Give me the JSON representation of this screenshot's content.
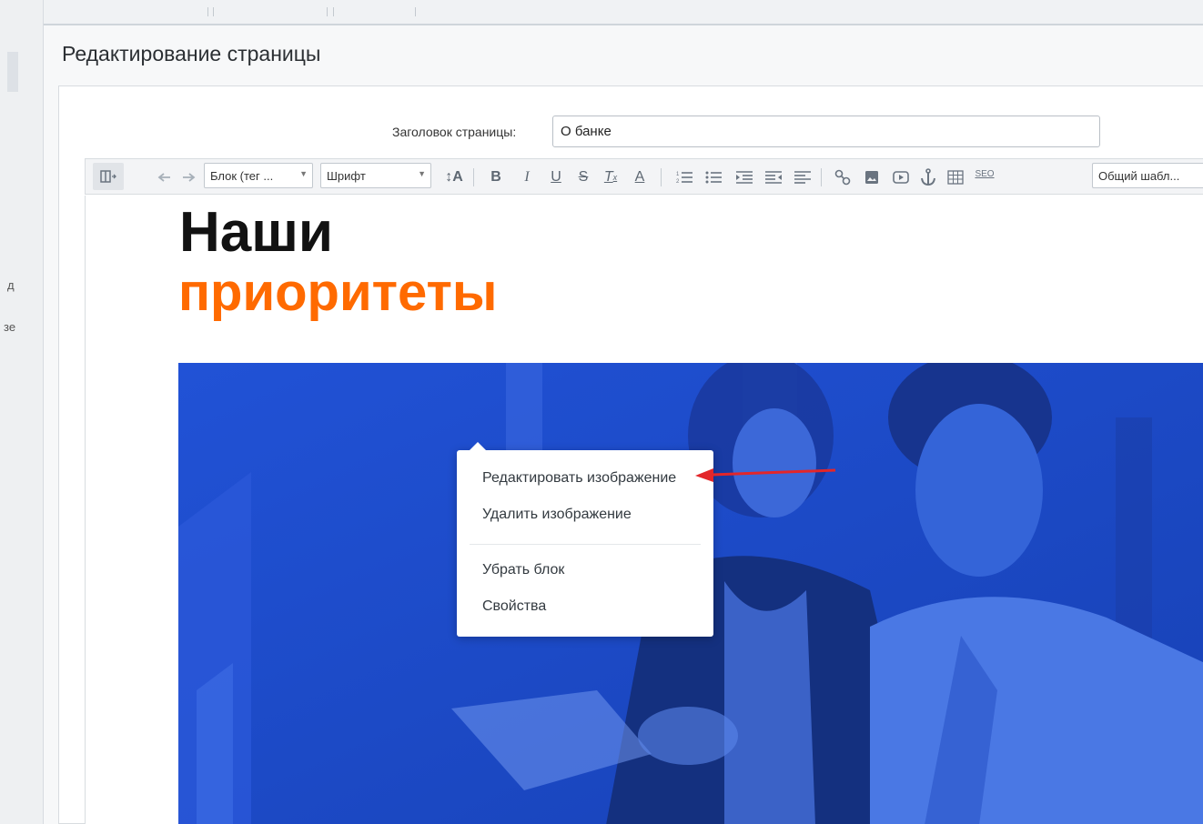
{
  "left_strip": {
    "fragment_1": "д",
    "fragment_2": "зе"
  },
  "panel": {
    "title": "Редактирование страницы"
  },
  "page_title_field": {
    "label": "Заголовок страницы:",
    "value": "О банке"
  },
  "toolbar": {
    "block_select": "Блок (тег ...",
    "font_select": "Шрифт",
    "seo_label": "SEO",
    "template_select": "Общий шабл...",
    "icons": [
      "source-toggle-icon",
      "undo-icon",
      "redo-icon",
      "font-size-icon",
      "bold-icon",
      "italic-icon",
      "underline-icon",
      "strikethrough-icon",
      "clear-format-icon",
      "text-color-icon",
      "ordered-list-icon",
      "unordered-list-icon",
      "indent-icon",
      "outdent-icon",
      "align-icon",
      "link-icon",
      "image-icon",
      "video-icon",
      "anchor-icon",
      "table-icon",
      "seo-icon"
    ]
  },
  "content": {
    "heading_line1": "Наши",
    "heading_line2": "приоритеты",
    "heading_accent_color": "#ff6a00",
    "image_overlay_color": "#1e4cc9"
  },
  "context_menu": {
    "items": [
      {
        "label": "Редактировать изображение"
      },
      {
        "label": "Удалить изображение"
      },
      {
        "label": "Убрать блок"
      },
      {
        "label": "Свойства"
      }
    ]
  },
  "annotation": {
    "arrow_color": "#e3262a"
  }
}
